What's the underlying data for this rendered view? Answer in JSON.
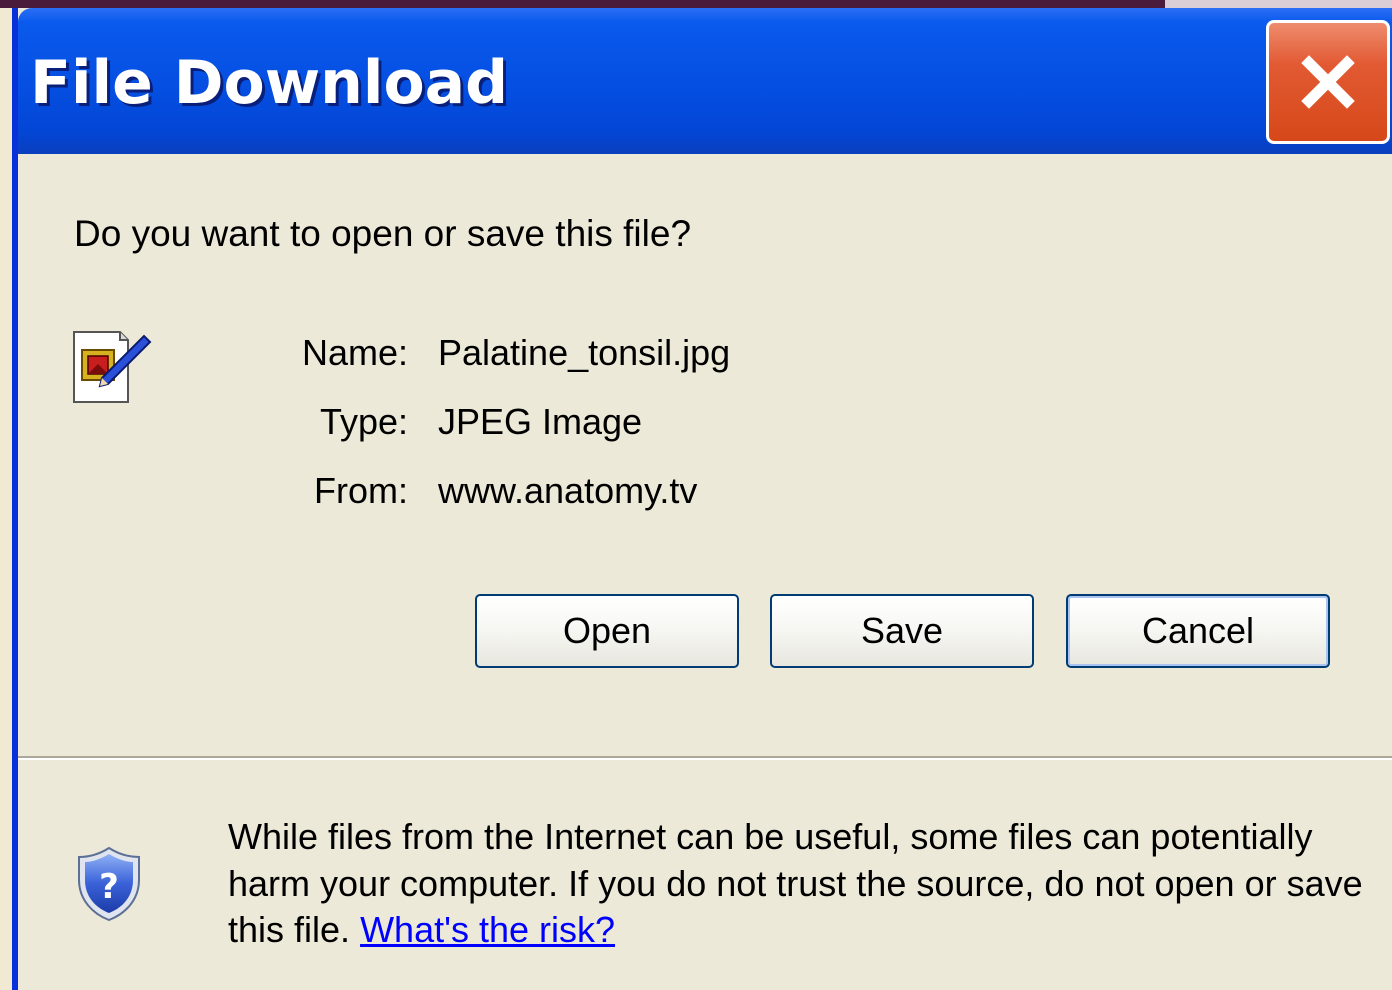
{
  "dialog": {
    "title": "File Download",
    "close_label": "close-icon",
    "prompt": "Do you want to open or save this file?",
    "file": {
      "icon": "image-file-icon",
      "name_label": "Name:",
      "name_value": "Palatine_tonsil.jpg",
      "type_label": "Type:",
      "type_value": "JPEG Image",
      "from_label": "From:",
      "from_value": "www.anatomy.tv"
    },
    "buttons": {
      "open": "Open",
      "save": "Save",
      "cancel": "Cancel"
    },
    "warning": {
      "icon": "shield-question-icon",
      "text": "While files from the Internet can be useful, some files can potentially harm your computer. If you do not trust the source, do not open or save this file.",
      "link": "What's the risk?"
    }
  },
  "colors": {
    "titlebar": "#0550e3",
    "close_button": "#d64819",
    "dialog_background": "#ece9d8",
    "button_border": "#003c74",
    "link": "#0000ff"
  }
}
